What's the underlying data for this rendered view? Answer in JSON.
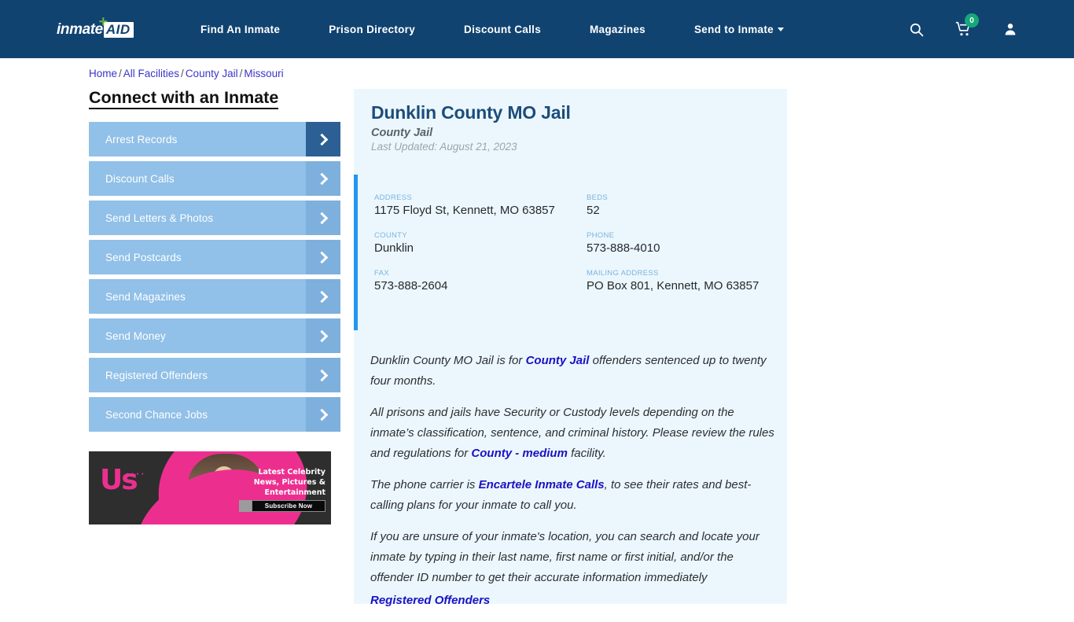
{
  "nav": {
    "logo": {
      "inmate": "inmate",
      "aid": "AID",
      "cross": "✛"
    },
    "links": [
      {
        "label": "Find An Inmate"
      },
      {
        "label": "Prison Directory"
      },
      {
        "label": "Discount Calls"
      },
      {
        "label": "Magazines"
      },
      {
        "label": "Send to Inmate",
        "has_caret": true
      }
    ],
    "icons": {
      "search": "search-icon",
      "cart": "cart-icon",
      "cart_count": "0",
      "account": "user-icon"
    },
    "background_color": "#114371",
    "badge_color": "#15a87a"
  },
  "breadcrumb": {
    "items": [
      "Home",
      "All Facilities",
      "County Jail",
      "Missouri"
    ],
    "separator": "/",
    "link_color": "#3b34c9"
  },
  "sidebar": {
    "title": "Connect with an Inmate",
    "items": [
      {
        "label": "Arrest Records",
        "active": true
      },
      {
        "label": "Discount Calls",
        "active": false
      },
      {
        "label": "Send Letters & Photos",
        "active": false
      },
      {
        "label": "Send Postcards",
        "active": false
      },
      {
        "label": "Send Magazines",
        "active": false
      },
      {
        "label": "Send Money",
        "active": false
      },
      {
        "label": "Registered Offenders",
        "active": false
      },
      {
        "label": "Second Chance Jobs",
        "active": false
      }
    ],
    "button_color": "#91c0e8",
    "arrow_color": "#7eb0dd",
    "arrow_active_color": "#2c6094"
  },
  "ad": {
    "brand": "Us",
    "brand_dots": "• • • •",
    "headline": "Latest Celebrity News, Pictures & Entertainment",
    "cta": "Subscribe Now",
    "accent_color": "#ec2f8f"
  },
  "facility": {
    "name": "Dunklin County MO Jail",
    "type": "County Jail",
    "last_updated": "Last Updated: August 21, 2023",
    "accent_color": "#2196f3",
    "panel_color": "#ecf7fd",
    "details": [
      {
        "label": "ADDRESS",
        "value": "1175 Floyd St, Kennett, MO 63857"
      },
      {
        "label": "BEDS",
        "value": "52"
      },
      {
        "label": "COUNTY",
        "value": "Dunklin"
      },
      {
        "label": "PHONE",
        "value": "573-888-4010"
      },
      {
        "label": "FAX",
        "value": "573-888-2604"
      },
      {
        "label": "MAILING ADDRESS",
        "value": "PO Box 801, Kennett, MO 63857"
      }
    ]
  },
  "body": {
    "p1_a": "Dunklin County MO Jail is for ",
    "p1_link": "County Jail",
    "p1_b": " offenders sentenced up to twenty four months.",
    "p2_a": "All prisons and jails have Security or Custody levels depending on the inmate’s classification, sentence, and criminal history. Please review the rules and regulations for ",
    "p2_link": "County - medium",
    "p2_b": " facility.",
    "p3_a": "The phone carrier is ",
    "p3_link": "Encartele Inmate Calls",
    "p3_b": ", to see their rates and best-calling plans for your inmate to call you.",
    "p4": "If you are unsure of your inmate's location, you can search and locate your inmate by typing in their last name, first name or first initial, and/or the offender ID number to get their accurate information immediately",
    "p5_link": "Registered Offenders",
    "link_color": "#1a12c4"
  }
}
